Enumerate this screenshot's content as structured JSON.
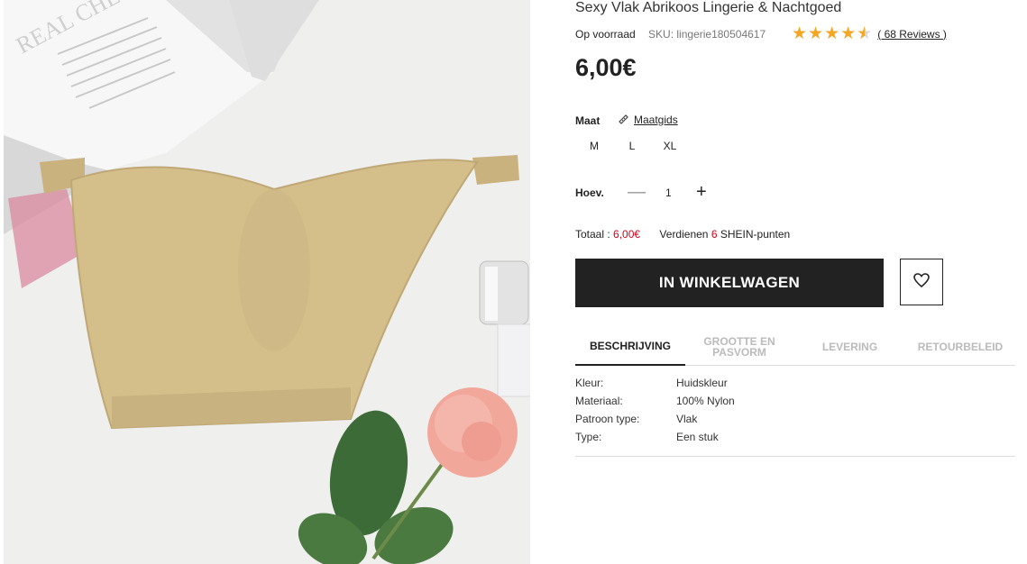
{
  "product": {
    "title": "Sexy Vlak Abrikoos Lingerie & Nachtgoed",
    "stock": "Op voorraad",
    "sku": "SKU: lingerie180504617",
    "rating_value": 4.5,
    "reviews": "( 68 Reviews )",
    "price": "6,00€"
  },
  "size": {
    "label": "Maat",
    "guide_label": "Maatgids",
    "options": [
      "M",
      "L",
      "XL"
    ]
  },
  "quantity": {
    "label": "Hoev.",
    "minus": "—",
    "value": "1",
    "plus": "+"
  },
  "total": {
    "label": "Totaal :",
    "value": "6,00€",
    "earn_pre": "Verdienen",
    "earn_points": "6",
    "earn_post": "SHEIN-punten"
  },
  "actions": {
    "add_to_cart": "IN WINKELWAGEN",
    "wishlist_icon": "heart-icon"
  },
  "tabs": [
    {
      "label": "BESCHRIJVING",
      "active": true
    },
    {
      "label": "GROOTTE EN PASVORM",
      "active": false
    },
    {
      "label": "LEVERING",
      "active": false
    },
    {
      "label": "RETOURBELEID",
      "active": false
    }
  ],
  "description": [
    {
      "key": "Kleur:",
      "value": "Huidskleur"
    },
    {
      "key": "Materiaal:",
      "value": "100% Nylon"
    },
    {
      "key": "Patroon type:",
      "value": "Vlak"
    },
    {
      "key": "Type:",
      "value": "Een stuk"
    }
  ],
  "photo": {
    "magazine_text": "REAL CHEC"
  },
  "colors": {
    "accent_red": "#d0021b",
    "star": "#f5a623",
    "button": "#222222"
  }
}
